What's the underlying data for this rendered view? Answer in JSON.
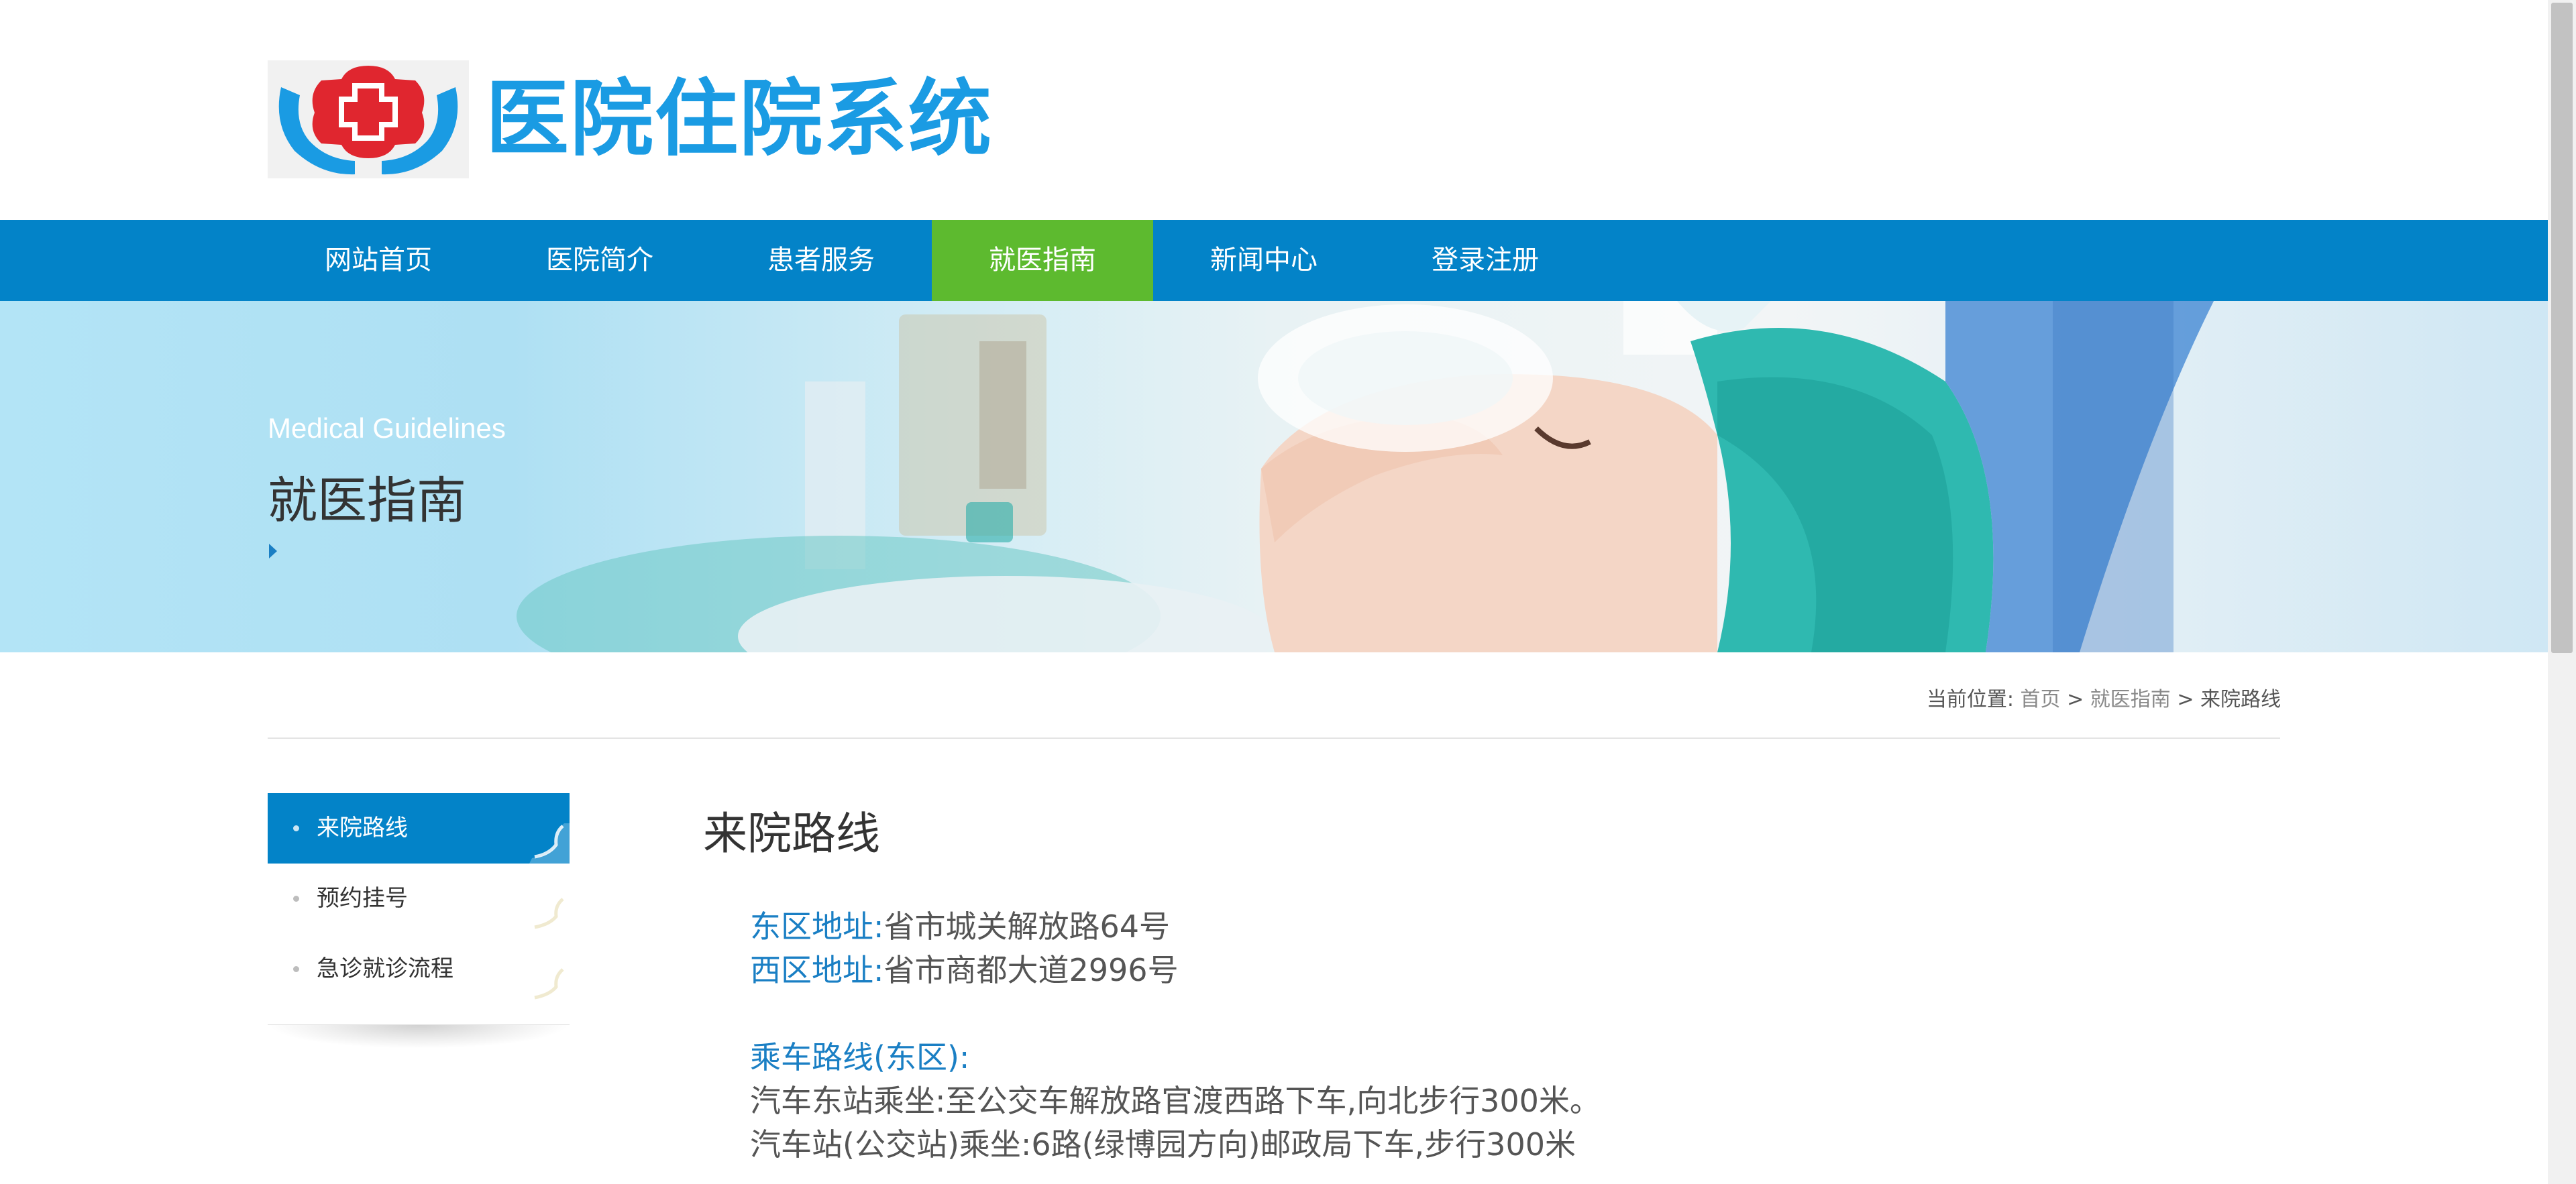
{
  "header": {
    "site_title": "医院住院系统",
    "colors": {
      "title": "#1a9be3",
      "emblem_cross": "#e0262f",
      "emblem_hands": "#1a9be3"
    }
  },
  "nav": {
    "items": [
      {
        "label": "网站首页",
        "active": false
      },
      {
        "label": "医院简介",
        "active": false
      },
      {
        "label": "患者服务",
        "active": false
      },
      {
        "label": "就医指南",
        "active": true
      },
      {
        "label": "新闻中心",
        "active": false
      },
      {
        "label": "登录注册",
        "active": false
      }
    ],
    "colors": {
      "bar": "#0383c8",
      "active": "#5dba2f"
    }
  },
  "banner": {
    "subtitle_en": "Medical Guidelines",
    "title_cn": "就医指南"
  },
  "breadcrumb": {
    "prefix": "当前位置:",
    "home": "首页",
    "sep1": ">",
    "section": "就医指南",
    "sep2": ">",
    "current": "来院路线"
  },
  "sidebar": {
    "items": [
      {
        "label": "来院路线",
        "active": true
      },
      {
        "label": "预约挂号",
        "active": false
      },
      {
        "label": "急诊就诊流程",
        "active": false
      }
    ]
  },
  "content": {
    "title": "来院路线",
    "east_label": "东区地址:",
    "east_value": "省市城关解放路64号",
    "west_label": "西区地址:",
    "west_value": "省市商都大道2996号",
    "route_label": "乘车路线(东区):",
    "route_line1": "汽车东站乘坐:至公交车解放路官渡西路下车,向北步行300米。",
    "route_line2": "汽车站(公交站)乘坐:6路(绿博园方向)邮政局下车,步行300米"
  }
}
